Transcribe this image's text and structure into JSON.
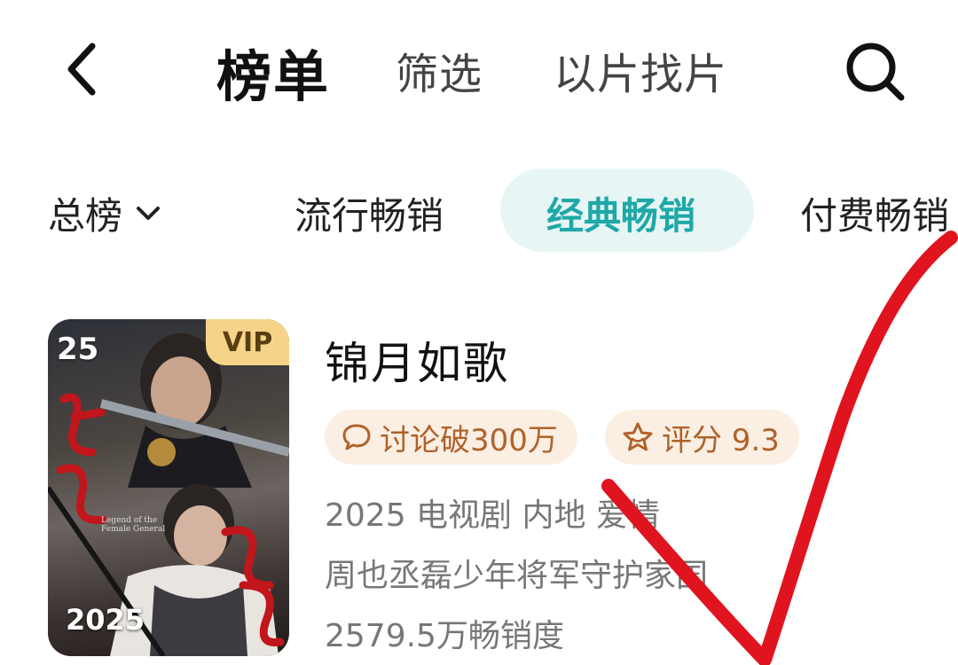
{
  "header": {
    "title": "榜单",
    "filter_label": "筛选",
    "image_search_label": "以片找片"
  },
  "tabs": {
    "total": "总榜",
    "popular": "流行畅销",
    "classic": "经典畅销",
    "paid": "付费畅销"
  },
  "colors": {
    "accent": "#1fa8a8",
    "tab_active_bg": "#e7f5f5",
    "chip_bg": "#fbefe3",
    "chip_text": "#b0622a",
    "vip_bg": "#f5d489",
    "annotation": "#e0141e"
  },
  "show": {
    "rank": "25",
    "vip": "VIP",
    "poster_year": "2025",
    "poster_en_title": "Legend of the Female General",
    "title": "锦月如歌",
    "discussion": "讨论破300万",
    "rating": "评分 9.3",
    "tags": "2025 电视剧 内地 爱情",
    "description": "周也丞磊少年将军守护家国",
    "sales": "2579.5万畅销度"
  }
}
